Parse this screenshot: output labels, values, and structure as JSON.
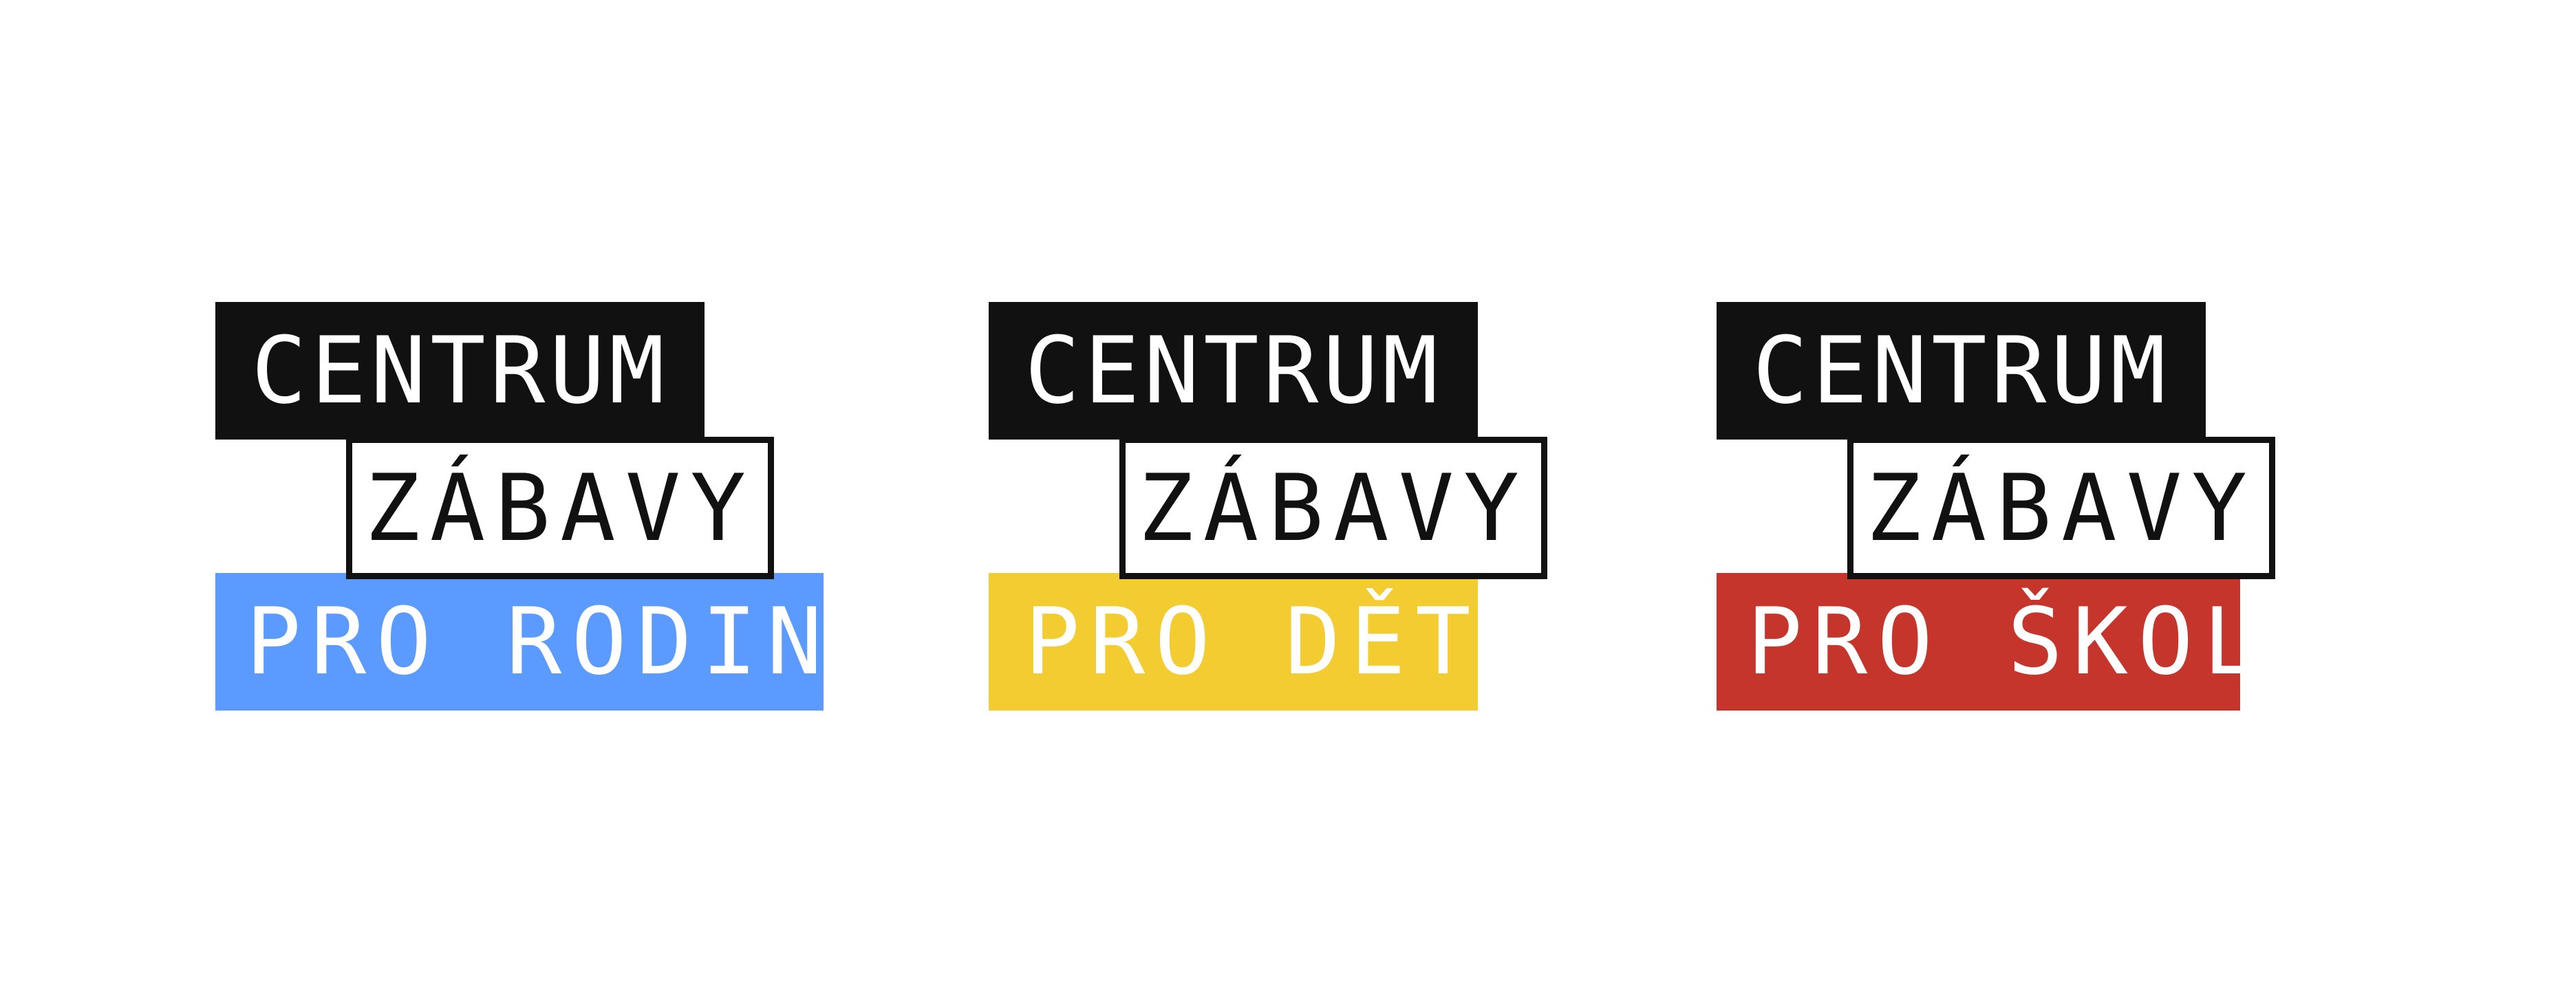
{
  "logos": [
    {
      "line1": "CENTRUM",
      "line2": "ZÁBAVY",
      "line3": "PRO RODINY",
      "accent": "#5B9BFF"
    },
    {
      "line1": "CENTRUM",
      "line2": "ZÁBAVY",
      "line3": "PRO DĚTI",
      "accent": "#F2CC30"
    },
    {
      "line1": "CENTRUM",
      "line2": "ZÁBAVY",
      "line3": "PRO ŠKOLY",
      "accent": "#C5352C"
    }
  ],
  "colors": {
    "black": "#111111",
    "background": "#FFFFFF"
  }
}
